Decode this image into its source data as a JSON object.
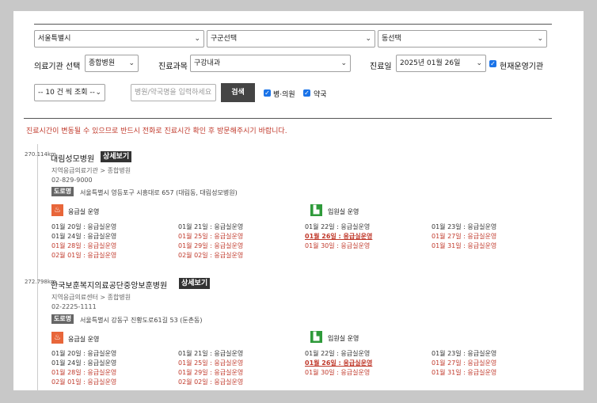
{
  "filters": {
    "region": "서울특별시",
    "district": "구군선택",
    "dong": "동선택",
    "type_label": "의료기관 선택",
    "type_value": "종합병원",
    "dept_label": "진료과목",
    "dept_value": "구강내과",
    "date_label": "진료일",
    "date_value": "2025년 01월 26일",
    "operating_label": "현재운영기관",
    "page_size": "-- 10 건 씩 조회 --",
    "search_placeholder": "병원/약국명을 입력하세요",
    "search_button": "검색",
    "hospital_label": "병·의원",
    "pharmacy_label": "약국"
  },
  "notice": "진료시간이 변동될 수 있으므로 반드시 전화로 진료시간 확인 후 방문해주시기 바랍니다.",
  "hospitals": [
    {
      "distance": "270.114km",
      "name": "대림성모병원",
      "detail": "상세보기",
      "category": "지역응급의료기관 > 종합병원",
      "phone": "02-829-9000",
      "road_tag": "도로명",
      "address": "서울특별시 영등포구 시흥대로 657 (대림동, 대림성모병원)",
      "er_label": "응급실 운영",
      "adm_label": "입원실 운영",
      "schedule": [
        [
          "01월 20일 : 응급실운영",
          "01월 21일 : 응급실운영",
          "01월 22일 : 응급실운영",
          "01월 23일 : 응급실운영"
        ],
        [
          "01월 24일 : 응급실운영",
          "01월 25일 : 응급실운영",
          "01월 26일 : 응급실운영",
          "01월 27일 : 응급실운영"
        ],
        [
          "01월 28일 : 응급실운영",
          "01월 29일 : 응급실운영",
          "01월 30일 : 응급실운영",
          "01월 31일 : 응급실운영"
        ],
        [
          "02월 01일 : 응급실운영",
          "02월 02일 : 응급실운영"
        ]
      ]
    },
    {
      "distance": "272.798km",
      "name": "한국보훈복지의료공단중앙보훈병원",
      "detail": "상세보기",
      "category": "지역응급의료센터 > 종합병원",
      "phone": "02-2225-1111",
      "road_tag": "도로명",
      "address": "서울특별시 강동구 진황도로61길 53 (둔촌동)",
      "er_label": "응급실 운영",
      "adm_label": "입원실 운영",
      "schedule": [
        [
          "01월 20일 : 응급실운영",
          "01월 21일 : 응급실운영",
          "01월 22일 : 응급실운영",
          "01월 23일 : 응급실운영"
        ],
        [
          "01월 24일 : 응급실운영",
          "01월 25일 : 응급실운영",
          "01월 26일 : 응급실운영",
          "01월 27일 : 응급실운영"
        ],
        [
          "01월 28일 : 응급실운영",
          "01월 29일 : 응급실운영",
          "01월 30일 : 응급실운영",
          "01월 31일 : 응급실운영"
        ],
        [
          "02월 01일 : 응급실운영",
          "02월 02일 : 응급실운영"
        ]
      ]
    }
  ]
}
